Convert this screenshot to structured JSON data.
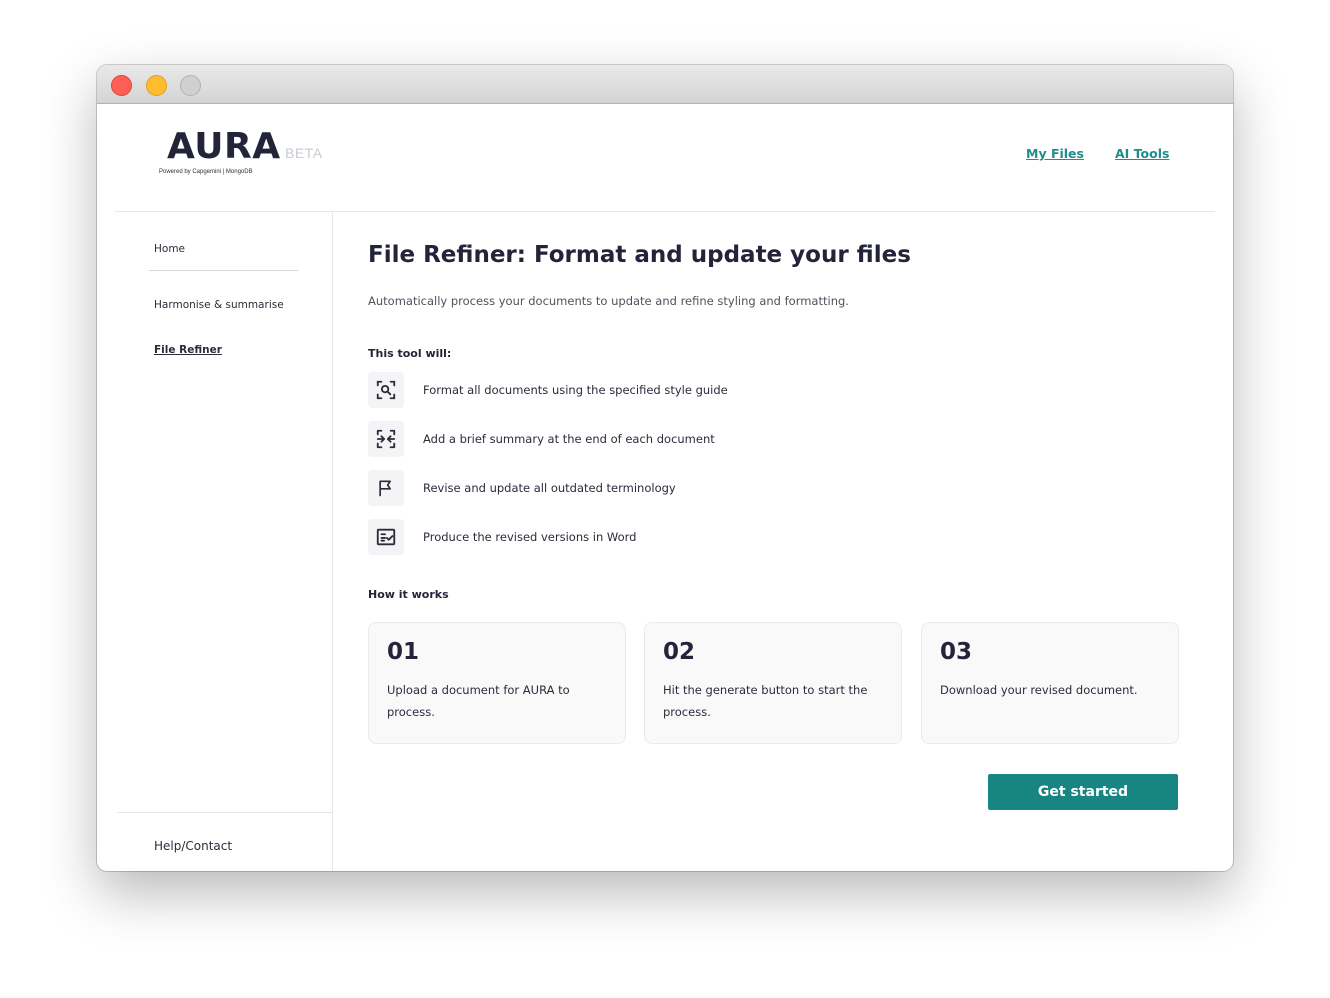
{
  "logo": {
    "name": "AURA",
    "badge": "BETA",
    "powered_by": "Powered by Capgemini | MongoDB"
  },
  "top_nav": {
    "my_files": "My Files",
    "ai_tools": "AI Tools"
  },
  "sidebar": {
    "home": "Home",
    "harmonise": "Harmonise & summarise",
    "file_refiner": "File Refiner",
    "help": "Help/Contact"
  },
  "main": {
    "title": "File Refiner: Format and update your files",
    "subtitle": "Automatically process your documents to update and refine styling and formatting.",
    "tool_will_heading": "This tool will:",
    "features": [
      {
        "icon": "document-search-icon",
        "text": "Format all documents using the specified style guide"
      },
      {
        "icon": "compress-icon",
        "text": "Add a brief summary at the end of each document"
      },
      {
        "icon": "flag-icon",
        "text": "Revise and update all outdated terminology"
      },
      {
        "icon": "checklist-icon",
        "text": "Produce the revised versions in Word"
      }
    ],
    "how_heading": "How it works",
    "steps": [
      {
        "num": "01",
        "desc": "Upload a document for AURA to process."
      },
      {
        "num": "02",
        "desc": "Hit the generate button to start the process."
      },
      {
        "num": "03",
        "desc": "Download your revised document."
      }
    ],
    "cta": "Get started"
  },
  "colors": {
    "accent": "#178683",
    "link": "#1d8e8a",
    "heading": "#23243a"
  }
}
